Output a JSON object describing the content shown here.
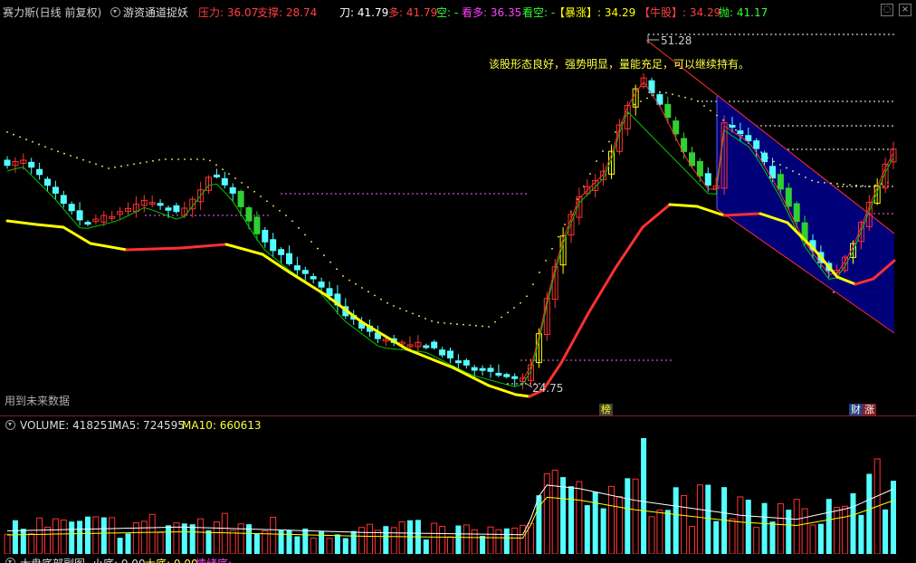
{
  "header": {
    "title": "赛力斯(日线 前复权)",
    "indicator_name": "游资通道捉妖",
    "pressure_label": "压力: 36.07",
    "support_label": "支撑: 28.74",
    "knife_label": "刀: 41.79",
    "bull_label": "多: 41.79",
    "bear_label": "空: -",
    "watch_bull_label": "看多: 36.35",
    "watch_bear_label": "看空: -",
    "surge_label": "【暴涨】: 34.29",
    "bull_stock_label": "【牛股】: 34.29",
    "sell_label": "抛: 41.17"
  },
  "main": {
    "high_price_label": "51.28",
    "low_price_label": "24.75",
    "note": "该股形态良好，强势明显，量能充足，可以继续持有。",
    "future_data_label": "用到未来数据",
    "badge_list": "榜",
    "badge_finance": "财",
    "badge_rise": "涨"
  },
  "volume": {
    "label": "VOLUME: 418251",
    "ma5": "MA5: 724595",
    "ma10": "MA10: 660613"
  },
  "bottom": {
    "title": "大盘底部副图",
    "small_bottom": "小底: 0.00",
    "big_bottom": "大底: 0.00",
    "emotion_bottom": "情绪底:"
  },
  "colors": {
    "up": "#ff3232",
    "down": "#54ffff",
    "yellow": "#ffff00",
    "channel_fill": "#000080"
  }
}
